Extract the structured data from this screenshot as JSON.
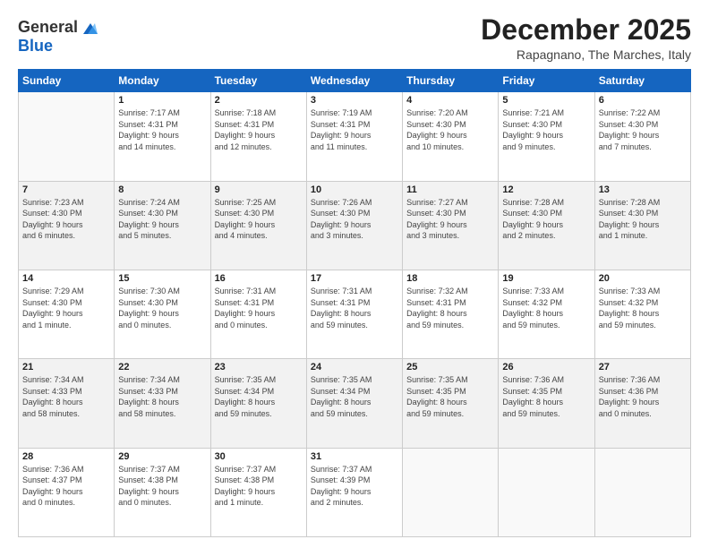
{
  "logo": {
    "general": "General",
    "blue": "Blue"
  },
  "header": {
    "month": "December 2025",
    "location": "Rapagnano, The Marches, Italy"
  },
  "weekdays": [
    "Sunday",
    "Monday",
    "Tuesday",
    "Wednesday",
    "Thursday",
    "Friday",
    "Saturday"
  ],
  "weeks": [
    [
      {
        "day": "",
        "info": ""
      },
      {
        "day": "1",
        "info": "Sunrise: 7:17 AM\nSunset: 4:31 PM\nDaylight: 9 hours\nand 14 minutes."
      },
      {
        "day": "2",
        "info": "Sunrise: 7:18 AM\nSunset: 4:31 PM\nDaylight: 9 hours\nand 12 minutes."
      },
      {
        "day": "3",
        "info": "Sunrise: 7:19 AM\nSunset: 4:31 PM\nDaylight: 9 hours\nand 11 minutes."
      },
      {
        "day": "4",
        "info": "Sunrise: 7:20 AM\nSunset: 4:30 PM\nDaylight: 9 hours\nand 10 minutes."
      },
      {
        "day": "5",
        "info": "Sunrise: 7:21 AM\nSunset: 4:30 PM\nDaylight: 9 hours\nand 9 minutes."
      },
      {
        "day": "6",
        "info": "Sunrise: 7:22 AM\nSunset: 4:30 PM\nDaylight: 9 hours\nand 7 minutes."
      }
    ],
    [
      {
        "day": "7",
        "info": "Sunrise: 7:23 AM\nSunset: 4:30 PM\nDaylight: 9 hours\nand 6 minutes."
      },
      {
        "day": "8",
        "info": "Sunrise: 7:24 AM\nSunset: 4:30 PM\nDaylight: 9 hours\nand 5 minutes."
      },
      {
        "day": "9",
        "info": "Sunrise: 7:25 AM\nSunset: 4:30 PM\nDaylight: 9 hours\nand 4 minutes."
      },
      {
        "day": "10",
        "info": "Sunrise: 7:26 AM\nSunset: 4:30 PM\nDaylight: 9 hours\nand 3 minutes."
      },
      {
        "day": "11",
        "info": "Sunrise: 7:27 AM\nSunset: 4:30 PM\nDaylight: 9 hours\nand 3 minutes."
      },
      {
        "day": "12",
        "info": "Sunrise: 7:28 AM\nSunset: 4:30 PM\nDaylight: 9 hours\nand 2 minutes."
      },
      {
        "day": "13",
        "info": "Sunrise: 7:28 AM\nSunset: 4:30 PM\nDaylight: 9 hours\nand 1 minute."
      }
    ],
    [
      {
        "day": "14",
        "info": "Sunrise: 7:29 AM\nSunset: 4:30 PM\nDaylight: 9 hours\nand 1 minute."
      },
      {
        "day": "15",
        "info": "Sunrise: 7:30 AM\nSunset: 4:30 PM\nDaylight: 9 hours\nand 0 minutes."
      },
      {
        "day": "16",
        "info": "Sunrise: 7:31 AM\nSunset: 4:31 PM\nDaylight: 9 hours\nand 0 minutes."
      },
      {
        "day": "17",
        "info": "Sunrise: 7:31 AM\nSunset: 4:31 PM\nDaylight: 8 hours\nand 59 minutes."
      },
      {
        "day": "18",
        "info": "Sunrise: 7:32 AM\nSunset: 4:31 PM\nDaylight: 8 hours\nand 59 minutes."
      },
      {
        "day": "19",
        "info": "Sunrise: 7:33 AM\nSunset: 4:32 PM\nDaylight: 8 hours\nand 59 minutes."
      },
      {
        "day": "20",
        "info": "Sunrise: 7:33 AM\nSunset: 4:32 PM\nDaylight: 8 hours\nand 59 minutes."
      }
    ],
    [
      {
        "day": "21",
        "info": "Sunrise: 7:34 AM\nSunset: 4:33 PM\nDaylight: 8 hours\nand 58 minutes."
      },
      {
        "day": "22",
        "info": "Sunrise: 7:34 AM\nSunset: 4:33 PM\nDaylight: 8 hours\nand 58 minutes."
      },
      {
        "day": "23",
        "info": "Sunrise: 7:35 AM\nSunset: 4:34 PM\nDaylight: 8 hours\nand 59 minutes."
      },
      {
        "day": "24",
        "info": "Sunrise: 7:35 AM\nSunset: 4:34 PM\nDaylight: 8 hours\nand 59 minutes."
      },
      {
        "day": "25",
        "info": "Sunrise: 7:35 AM\nSunset: 4:35 PM\nDaylight: 8 hours\nand 59 minutes."
      },
      {
        "day": "26",
        "info": "Sunrise: 7:36 AM\nSunset: 4:35 PM\nDaylight: 8 hours\nand 59 minutes."
      },
      {
        "day": "27",
        "info": "Sunrise: 7:36 AM\nSunset: 4:36 PM\nDaylight: 9 hours\nand 0 minutes."
      }
    ],
    [
      {
        "day": "28",
        "info": "Sunrise: 7:36 AM\nSunset: 4:37 PM\nDaylight: 9 hours\nand 0 minutes."
      },
      {
        "day": "29",
        "info": "Sunrise: 7:37 AM\nSunset: 4:38 PM\nDaylight: 9 hours\nand 0 minutes."
      },
      {
        "day": "30",
        "info": "Sunrise: 7:37 AM\nSunset: 4:38 PM\nDaylight: 9 hours\nand 1 minute."
      },
      {
        "day": "31",
        "info": "Sunrise: 7:37 AM\nSunset: 4:39 PM\nDaylight: 9 hours\nand 2 minutes."
      },
      {
        "day": "",
        "info": ""
      },
      {
        "day": "",
        "info": ""
      },
      {
        "day": "",
        "info": ""
      }
    ]
  ]
}
